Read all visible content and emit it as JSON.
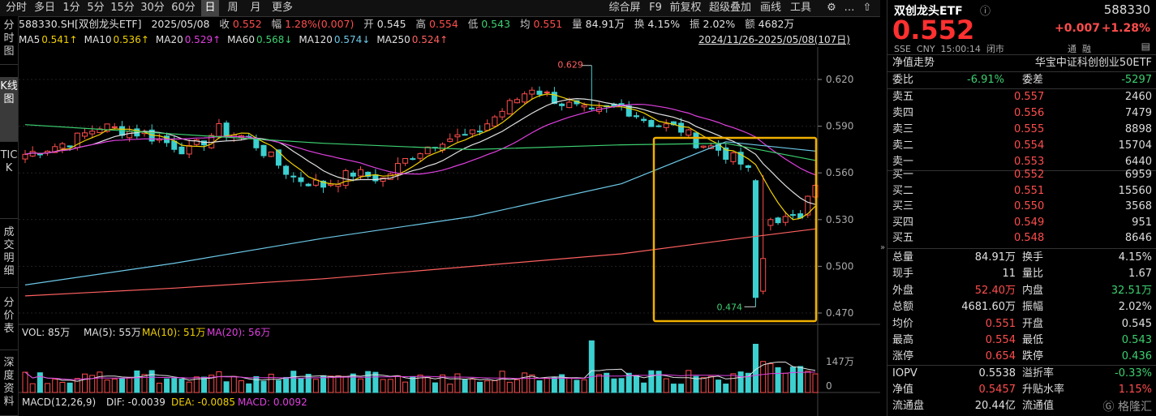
{
  "toolbar": {
    "tabs": [
      "分时",
      "多日",
      "1分",
      "5分",
      "15分",
      "30分",
      "60分",
      "日",
      "周",
      "月",
      "更多"
    ],
    "active_tab": "日",
    "right_items": [
      "综合屏",
      "F9",
      "前复权",
      "超级叠加",
      "画线",
      "工具"
    ]
  },
  "left_tabs": [
    "分时图",
    "K线图",
    "TICK",
    "成交明细",
    "分价表",
    "深度资料"
  ],
  "info": {
    "code": "588330.SH[双创龙头ETF]",
    "date": "2025/05/08",
    "close_label": "收",
    "close": "0.552",
    "change_label": "幅",
    "change": "1.28%(0.007)",
    "open_label": "开",
    "open": "0.545",
    "high_label": "高",
    "high": "0.554",
    "low_label": "低",
    "low": "0.543",
    "avg_label": "均",
    "avg": "0.551",
    "vol_label": "量",
    "vol": "84.91万",
    "turnover_label": "换",
    "turnover": "4.15%",
    "amp_label": "振",
    "amp": "2.02%",
    "amount_label": "额",
    "amount": "4682万"
  },
  "ma": [
    {
      "label": "MA5",
      "value": "0.541↑",
      "color": "#f0d000"
    },
    {
      "label": "MA10",
      "value": "0.536↑",
      "color": "#f0d000"
    },
    {
      "label": "MA20",
      "value": "0.529↑",
      "color": "#e040e0"
    },
    {
      "label": "MA60",
      "value": "0.568↓",
      "color": "#3cd070"
    },
    {
      "label": "MA120",
      "value": "0.574↓",
      "color": "#6cc8e8"
    },
    {
      "label": "MA250",
      "value": "0.524↑",
      "color": "#ff6060"
    }
  ],
  "date_range": "2024/11/26-2025/05/08(107日)",
  "price_axis": [
    "0.620",
    "0.590",
    "0.560",
    "0.530",
    "0.500",
    "0.470"
  ],
  "annotations": {
    "high": "0.629",
    "low": "0.474"
  },
  "vol_panel": {
    "label": "VOL: 85万",
    "ma5": "MA(5): 55万",
    "ma10": "MA(10): 51万",
    "ma20": "MA(20): 56万",
    "axis": [
      "147万",
      "0"
    ]
  },
  "macd_panel": {
    "label": "MACD(12,26,9)",
    "dif": "DIF: -0.0039",
    "dea": "DEA: -0.0085",
    "macd": "MACD: 0.0092"
  },
  "right": {
    "name": "双创龙头ETF",
    "code": "588330",
    "price": "0.552",
    "change": "+0.007",
    "change_pct": "+1.28%",
    "meta": "SSE  CNY  15:00:14  闭市",
    "meta_right": "通  融",
    "nav_label": "净值走势",
    "index_name": "华宝中证科创创业50ETF",
    "weibi_label": "委比",
    "weibi": "-6.91%",
    "weicha_label": "委差",
    "weicha": "-5297",
    "asks": [
      {
        "label": "卖五",
        "price": "0.557",
        "vol": "2460"
      },
      {
        "label": "卖四",
        "price": "0.556",
        "vol": "7479"
      },
      {
        "label": "卖三",
        "price": "0.555",
        "vol": "8898"
      },
      {
        "label": "卖二",
        "price": "0.554",
        "vol": "15704"
      },
      {
        "label": "卖一",
        "price": "0.553",
        "vol": "6440"
      }
    ],
    "bids": [
      {
        "label": "买一",
        "price": "0.552",
        "vol": "6959"
      },
      {
        "label": "买二",
        "price": "0.551",
        "vol": "15560"
      },
      {
        "label": "买三",
        "price": "0.550",
        "vol": "3568"
      },
      {
        "label": "买四",
        "price": "0.549",
        "vol": "951"
      },
      {
        "label": "买五",
        "price": "0.548",
        "vol": "8646"
      }
    ],
    "stats": [
      {
        "l1": "总量",
        "v1": "84.91万",
        "c1": "#e0e0e0",
        "l2": "换手",
        "v2": "4.15%",
        "c2": "#e0e0e0"
      },
      {
        "l1": "现手",
        "v1": "11",
        "c1": "#e0e0e0",
        "l2": "量比",
        "v2": "1.67",
        "c2": "#e0e0e0"
      },
      {
        "l1": "外盘",
        "v1": "52.40万",
        "c1": "#ff4d4d",
        "l2": "内盘",
        "v2": "32.51万",
        "c2": "#3cd070"
      },
      {
        "l1": "总额",
        "v1": "4681.60万",
        "c1": "#e0e0e0",
        "l2": "振幅",
        "v2": "2.02%",
        "c2": "#e0e0e0"
      },
      {
        "l1": "均价",
        "v1": "0.551",
        "c1": "#ff4d4d",
        "l2": "开盘",
        "v2": "0.545",
        "c2": "#e0e0e0"
      },
      {
        "l1": "最高",
        "v1": "0.554",
        "c1": "#ff4d4d",
        "l2": "最低",
        "v2": "0.543",
        "c2": "#3cd070"
      },
      {
        "l1": "涨停",
        "v1": "0.654",
        "c1": "#ff4d4d",
        "l2": "跌停",
        "v2": "0.436",
        "c2": "#3cd070"
      }
    ],
    "stats2": [
      {
        "l1": "IOPV",
        "v1": "0.5538",
        "c1": "#e0e0e0",
        "l2": "溢折率",
        "v2": "-0.33%",
        "c2": "#3cd070"
      },
      {
        "l1": "净值",
        "v1": "0.5457",
        "c1": "#ff4d4d",
        "l2": "升贴水率",
        "v2": "1.15%",
        "c2": "#ff4d4d"
      },
      {
        "l1": "流通盘",
        "v1": "20.44亿",
        "c1": "#e0e0e0",
        "l2": "流通值",
        "v2": "",
        "c2": "#e0e0e0"
      }
    ],
    "watermark": "格隆汇"
  },
  "colors": {
    "up": "#ff4d4d",
    "down": "#3cd0d0",
    "highlight": "#f0b000"
  }
}
